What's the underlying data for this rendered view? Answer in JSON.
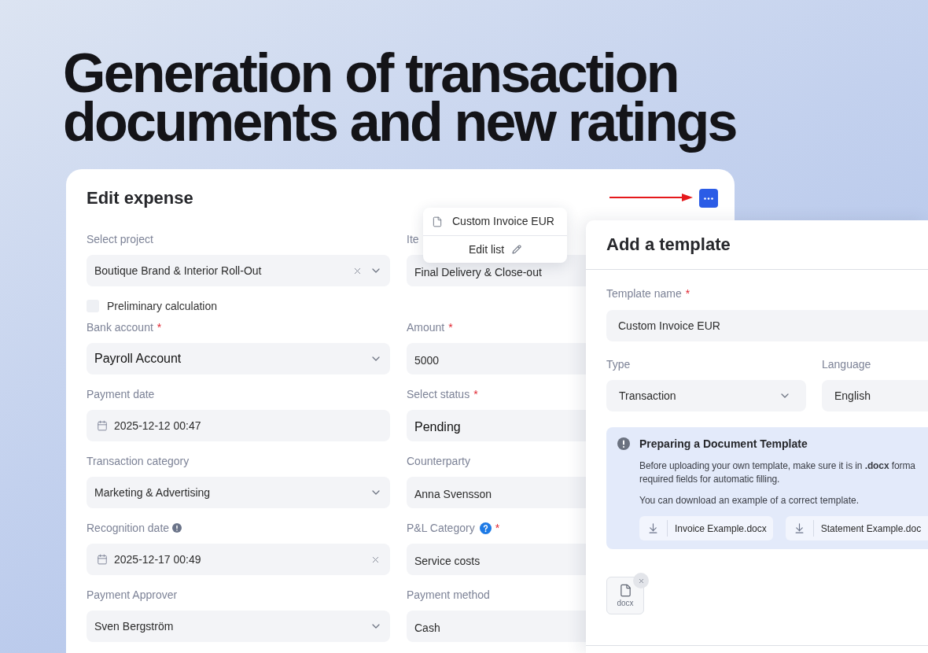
{
  "headline": "Generation of transaction documents and new ratings",
  "edit_expense": {
    "title": "Edit expense",
    "fields": [
      {
        "kind": "select",
        "label": "Select project",
        "value": "Boutique Brand & Interior Roll-Out",
        "clearable": true,
        "large": false
      },
      {
        "kind": "text",
        "label": "Ite",
        "value": "Final Delivery & Close-out",
        "clearable": false,
        "large": false
      },
      {
        "kind": "checkbox",
        "label": "Preliminary calculation",
        "checked": false
      },
      {
        "kind": "select",
        "label": "Bank account",
        "required_mark": "*",
        "value": "Payroll Account",
        "clearable": false,
        "large": true
      },
      {
        "kind": "text",
        "label": "Amount",
        "required_mark": "*",
        "value": "5000",
        "clearable": false,
        "large": false
      },
      {
        "kind": "date",
        "label": "Payment date",
        "value": "2025-12-12 00:47",
        "clearable": false,
        "large": false
      },
      {
        "kind": "text",
        "label": "Select status",
        "required_mark": "*",
        "value": "Pending",
        "clearable": false,
        "large": true
      },
      {
        "kind": "select",
        "label": "Transaction category",
        "value": "Marketing & Advertising",
        "clearable": false,
        "large": false
      },
      {
        "kind": "text",
        "label": "Counterparty",
        "value": "Anna Svensson",
        "clearable": false,
        "large": false
      },
      {
        "kind": "date",
        "label": "Recognition date",
        "hint": {
          "kind": "info"
        },
        "value": "2025-12-17 00:49",
        "clearable": true,
        "large": false
      },
      {
        "kind": "text",
        "label": "P&L Category",
        "hint": {
          "kind": "help"
        },
        "required_mark": "*",
        "value": "Service costs",
        "clearable": false,
        "large": false
      },
      {
        "kind": "select",
        "label": "Payment Approver",
        "value": "Sven Bergström",
        "clearable": false,
        "large": false
      },
      {
        "kind": "text",
        "label": "Payment method",
        "value": "Cash",
        "clearable": false,
        "large": false
      }
    ]
  },
  "template_menu": {
    "items": [
      {
        "label": "Custom Invoice EUR"
      }
    ],
    "edit_label": "Edit list"
  },
  "add_template": {
    "title": "Add a template",
    "name_field": {
      "label": "Template name",
      "required_mark": "*",
      "value": "Custom Invoice EUR"
    },
    "type_field": {
      "label": "Type",
      "value": "Transaction"
    },
    "language_field": {
      "label": "Language",
      "value": "English"
    },
    "notice": {
      "title": "Preparing a Document Template",
      "lines": [
        "Before uploading your own template, make sure it is in **.docx** forma",
        "required fields for automatic filling."
      ],
      "hint": "You can download an example of a correct template.",
      "downloads": [
        "Invoice Example.docx",
        "Statement Example.doc"
      ]
    },
    "attachments": [
      {
        "extension": "docx"
      }
    ]
  }
}
